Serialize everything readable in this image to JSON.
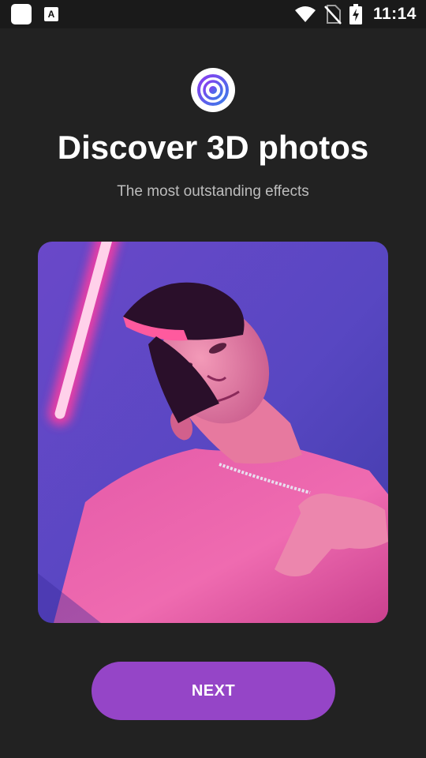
{
  "status_bar": {
    "time": "11:14",
    "notification_label": "A",
    "icons": [
      "square-notification-icon",
      "font-notification-icon",
      "wifi-icon",
      "no-sim-icon",
      "battery-charging-icon"
    ]
  },
  "onboarding": {
    "logo_icon": "3d-photo-logo-icon",
    "title": "Discover 3D photos",
    "subtitle": "The most outstanding effects",
    "hero_image": "neon-portrait-photo",
    "next_label": "NEXT"
  },
  "colors": {
    "background": "#222222",
    "button": "#9545c7",
    "logo_ring_outer": "#7a3ff0",
    "logo_ring_inner": "#3f6fe8"
  }
}
